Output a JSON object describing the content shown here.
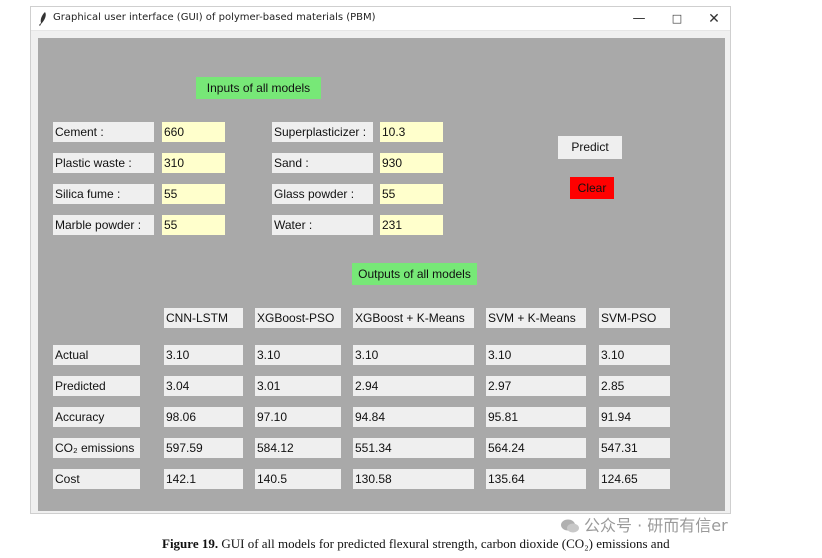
{
  "window": {
    "title": "Graphical user interface (GUI) of polymer-based materials (PBM)",
    "controls": {
      "minimize": "—",
      "maximize": "□",
      "close": "✕"
    }
  },
  "inputs": {
    "title": "Inputs of all models",
    "fields": [
      {
        "label": "Cement :",
        "value": "660"
      },
      {
        "label": "Plastic waste :",
        "value": "310"
      },
      {
        "label": "Silica fume :",
        "value": "55"
      },
      {
        "label": "Marble powder :",
        "value": "55"
      },
      {
        "label": "Superplasticizer :",
        "value": "10.3"
      },
      {
        "label": "Sand :",
        "value": "930"
      },
      {
        "label": "Glass powder :",
        "value": "55"
      },
      {
        "label": "Water :",
        "value": "231"
      }
    ],
    "predict_label": "Predict",
    "clear_label": "Clear"
  },
  "outputs": {
    "title": "Outputs of all models",
    "models": [
      "CNN-LSTM",
      "XGBoost-PSO",
      "XGBoost + K-Means",
      "SVM + K-Means",
      "SVM-PSO"
    ],
    "rows": [
      {
        "label": "Actual",
        "values": [
          "3.10",
          "3.10",
          "3.10",
          "3.10",
          "3.10"
        ]
      },
      {
        "label": "Predicted",
        "values": [
          "3.04",
          "3.01",
          "2.94",
          "2.97",
          "2.85"
        ]
      },
      {
        "label": "Accuracy",
        "values": [
          "98.06",
          "97.10",
          "94.84",
          "95.81",
          "91.94"
        ]
      },
      {
        "label": "CO₂ emissions",
        "values": [
          "597.59",
          "584.12",
          "551.34",
          "564.24",
          "547.31"
        ]
      },
      {
        "label": "Cost",
        "values": [
          "142.1",
          "140.5",
          "130.58",
          "135.64",
          "124.65"
        ]
      }
    ]
  },
  "watermark": "公众号 · 研而有信er",
  "caption": {
    "figure": "Figure 19.",
    "text": "GUI of all models for predicted flexural strength, carbon dioxide (CO₂) emissions and"
  },
  "colors": {
    "canvas": "#a9a9a9",
    "title_green": "#77e877",
    "entry_yellow": "#ffffcc",
    "clear_red": "#ff0000"
  }
}
